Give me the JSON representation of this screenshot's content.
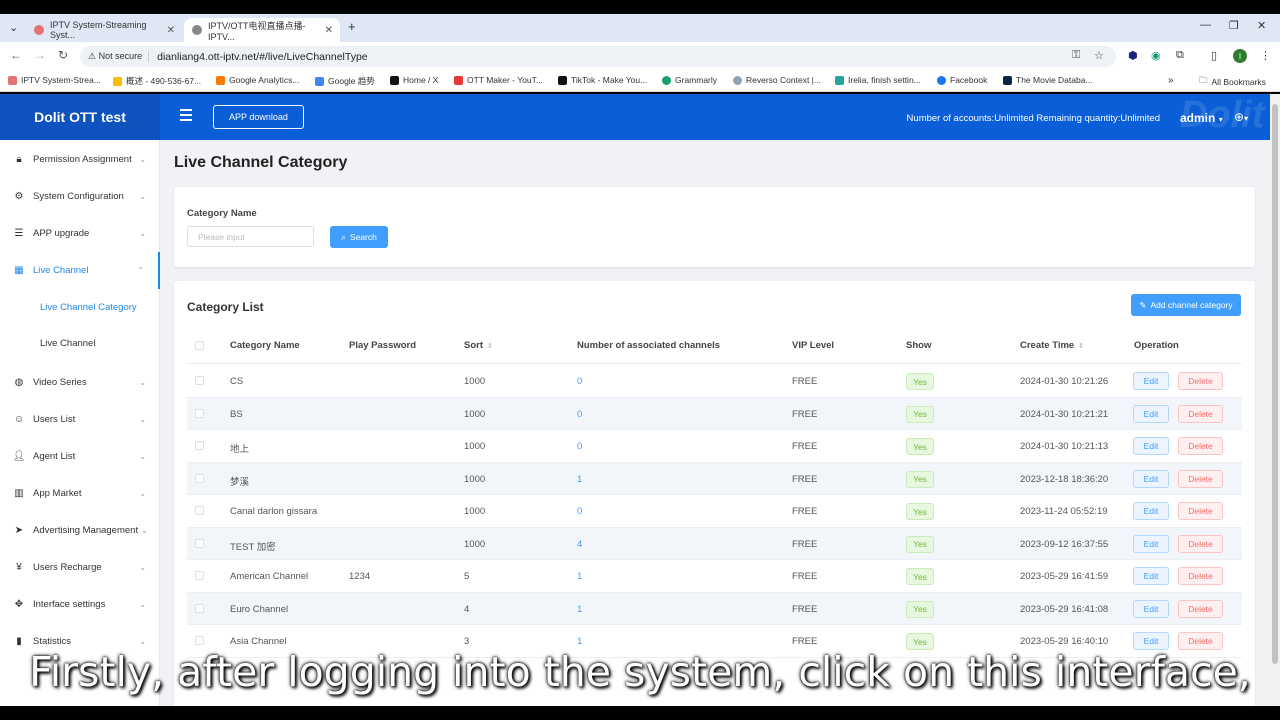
{
  "browser": {
    "tabs": [
      {
        "title": "IPTV System-Streaming Syst..."
      },
      {
        "title": "IPTV/OTT电视直播点播-IPTV..."
      }
    ],
    "security_label": "Not secure",
    "url": "dianliang4.ott-iptv.net/#/live/LiveChannelType",
    "bookmarks": [
      "IPTV System-Strea...",
      "概述 - 490-536-67...",
      "Google Analytics...",
      "Google 趋势",
      "Home / X",
      "OTT Maker - YouT...",
      "TikTok - Make You...",
      "Grammarly",
      "Reverso Context |...",
      "Irelia, finish settin...",
      "Facebook",
      "The Movie Databa..."
    ],
    "all_bookmarks": "All Bookmarks",
    "profile_initial": "I"
  },
  "header": {
    "brand": "Dolit OTT test",
    "app_download": "APP download",
    "accounts_text": "Number of accounts:Unlimited   Remaining quantity:Unlimited",
    "user": "admin"
  },
  "sidebar": {
    "items": [
      {
        "label": "Permission Assignment",
        "icon": "lock-icon"
      },
      {
        "label": "System Configuration",
        "icon": "gear-icon"
      },
      {
        "label": "APP upgrade",
        "icon": "list-icon"
      },
      {
        "label": "Live Channel",
        "icon": "grid-icon"
      },
      {
        "label": "Video Series",
        "icon": "globe-icon"
      },
      {
        "label": "Users List",
        "icon": "users-icon"
      },
      {
        "label": "Agent List",
        "icon": "agent-icon"
      },
      {
        "label": "App Market",
        "icon": "market-icon"
      },
      {
        "label": "Advertising Management",
        "icon": "send-icon"
      },
      {
        "label": "Users Recharge",
        "icon": "yen-icon"
      },
      {
        "label": "Interface settings",
        "icon": "move-icon"
      },
      {
        "label": "Statistics",
        "icon": "bar-chart-icon"
      }
    ],
    "sub_items": [
      {
        "label": "Live Channel Category"
      },
      {
        "label": "Live Channel"
      }
    ]
  },
  "main": {
    "page_title": "Live Channel Category",
    "filter": {
      "label": "Category Name",
      "placeholder": "Please input",
      "search_label": "Search"
    },
    "list": {
      "title": "Category List",
      "add_label": "Add channel category",
      "columns": [
        "Category Name",
        "Play Password",
        "Sort",
        "Number of associated channels",
        "VIP Level",
        "Show",
        "Create Time",
        "Operation"
      ],
      "edit_label": "Edit",
      "delete_label": "Delete",
      "rows": [
        {
          "name": "CS",
          "password": "",
          "sort": "1000",
          "channels": "0",
          "vip": "FREE",
          "show": "Yes",
          "created": "2024-01-30 10:21:26"
        },
        {
          "name": "BS",
          "password": "",
          "sort": "1000",
          "channels": "0",
          "vip": "FREE",
          "show": "Yes",
          "created": "2024-01-30 10:21:21"
        },
        {
          "name": "地上",
          "password": "",
          "sort": "1000",
          "channels": "0",
          "vip": "FREE",
          "show": "Yes",
          "created": "2024-01-30 10:21:13"
        },
        {
          "name": "梦溪",
          "password": "",
          "sort": "1000",
          "channels": "1",
          "vip": "FREE",
          "show": "Yes",
          "created": "2023-12-18 18:36:20"
        },
        {
          "name": "Canal darlon gissara",
          "password": "",
          "sort": "1000",
          "channels": "0",
          "vip": "FREE",
          "show": "Yes",
          "created": "2023-11-24 05:52:19"
        },
        {
          "name": "TEST 加密",
          "password": "",
          "sort": "1000",
          "channels": "4",
          "vip": "FREE",
          "show": "Yes",
          "created": "2023-09-12 16:37:55"
        },
        {
          "name": "American Channel",
          "password": "1234",
          "sort": "5",
          "channels": "1",
          "vip": "FREE",
          "show": "Yes",
          "created": "2023-05-29 16:41:59"
        },
        {
          "name": "Euro Channel",
          "password": "",
          "sort": "4",
          "channels": "1",
          "vip": "FREE",
          "show": "Yes",
          "created": "2023-05-29 16:41:08"
        },
        {
          "name": "Asia Channel",
          "password": "",
          "sort": "3",
          "channels": "1",
          "vip": "FREE",
          "show": "Yes",
          "created": "2023-05-29 16:40:10"
        }
      ]
    }
  },
  "caption": "Firstly, after logging into the system, click on this interface,"
}
